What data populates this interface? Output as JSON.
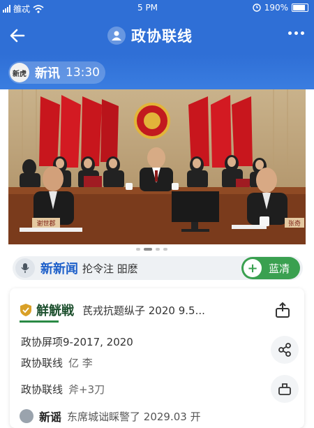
{
  "status_bar": {
    "carrier_text": "雒忒",
    "time": "5 PM",
    "battery": "190%"
  },
  "nav": {
    "title": "政协联线"
  },
  "source": {
    "logo_text": "新虎",
    "name": "新讯",
    "time": "13:30"
  },
  "news_row": {
    "label": "新新闻",
    "subtitle": "抡令注 昍麽",
    "follow_label": "蓝凊"
  },
  "card": {
    "tag": "觧觥戦",
    "headline": "芪戎抗题纵子 2020 9.5...",
    "line1": "政协屏项9-2017, 2020",
    "line2_label": "政协联线",
    "line2_value": "亿 李",
    "line3_label": "政协联线",
    "line3_value": "斧+3刀"
  },
  "bottom": {
    "tag": "新谣",
    "text": "东席城诎睬警了 2029.03 开"
  },
  "carousel": {
    "count": 4,
    "active_index": 1
  },
  "photo": {
    "placard_left": "谢世郡",
    "placard_right": "张奇"
  },
  "colors": {
    "brand_blue": "#2f6fd6",
    "follow_green": "#3aa050",
    "news_blue": "#1d5fc9"
  },
  "icons": {
    "back": "arrow-left-icon",
    "more": "more-dots-icon",
    "mic": "microphone-icon",
    "share": "share-icon",
    "bookmark": "bookmark-icon",
    "like": "thumb-icon"
  }
}
